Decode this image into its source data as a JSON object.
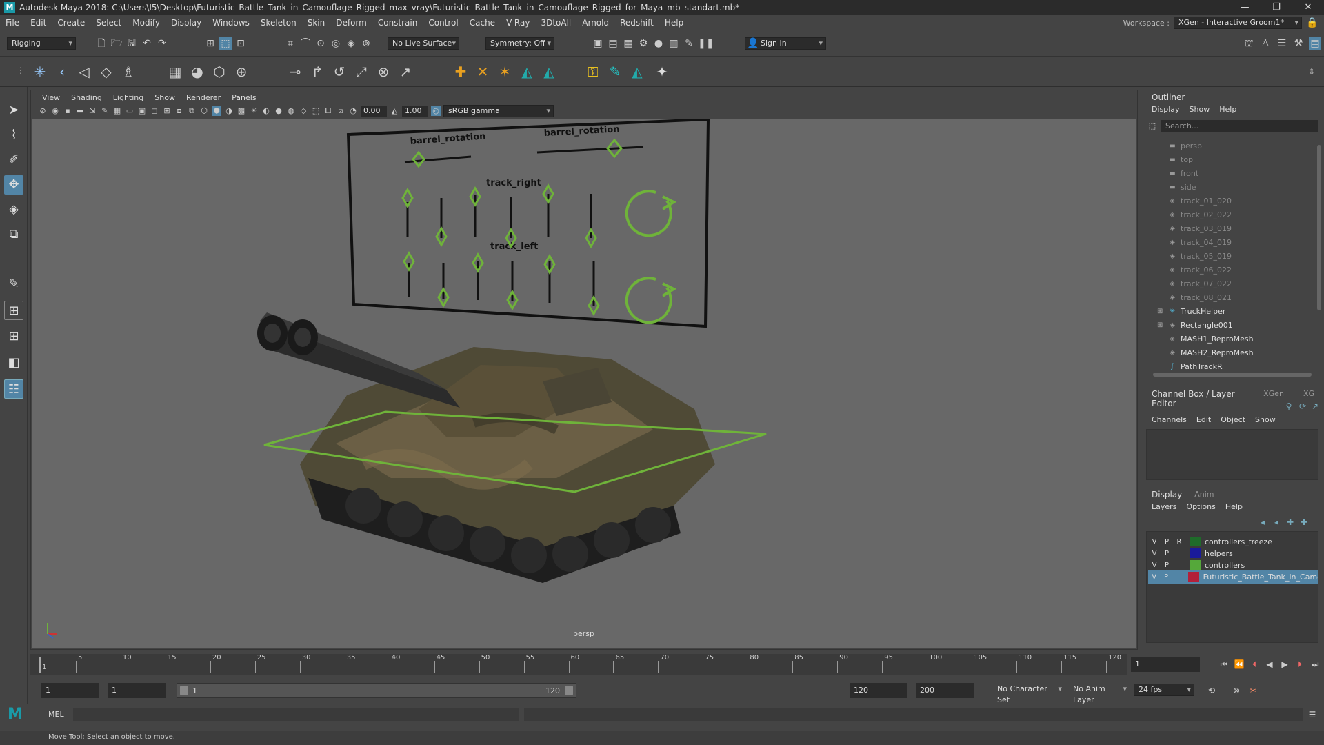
{
  "window": {
    "title": "Autodesk Maya 2018: C:\\Users\\I5\\Desktop\\Futuristic_Battle_Tank_in_Camouflage_Rigged_max_vray\\Futuristic_Battle_Tank_in_Camouflage_Rigged_for_Maya_mb_standart.mb*",
    "app_icon": "M"
  },
  "menu": [
    "File",
    "Edit",
    "Create",
    "Select",
    "Modify",
    "Display",
    "Windows",
    "Skeleton",
    "Skin",
    "Deform",
    "Constrain",
    "Control",
    "Cache",
    "V-Ray",
    "3DtoAll",
    "Arnold",
    "Redshift",
    "Help"
  ],
  "workspace": {
    "label": "Workspace :",
    "value": "XGen - Interactive Groom1*"
  },
  "status_line": {
    "mode": "Rigging",
    "live_surface": "No Live Surface",
    "symmetry": "Symmetry: Off",
    "sign_in": "Sign In"
  },
  "viewport": {
    "menus": [
      "View",
      "Shading",
      "Lighting",
      "Show",
      "Renderer",
      "Panels"
    ],
    "exposure": "0.00",
    "gamma": "1.00",
    "color_space": "sRGB gamma",
    "camera_label": "persp",
    "rig_labels": {
      "barrel_rotation_left": "barrel_rotation",
      "barrel_rotation_right": "barrel_rotation",
      "track_right": "track_right",
      "track_left": "track_left"
    }
  },
  "outliner": {
    "title": "Outliner",
    "menus": [
      "Display",
      "Show",
      "Help"
    ],
    "search_placeholder": "Search...",
    "items": [
      {
        "label": "persp",
        "icon": "camera-icon",
        "dim": true
      },
      {
        "label": "top",
        "icon": "camera-icon",
        "dim": true
      },
      {
        "label": "front",
        "icon": "camera-icon",
        "dim": true
      },
      {
        "label": "side",
        "icon": "camera-icon",
        "dim": true
      },
      {
        "label": "track_01_020",
        "icon": "mesh-icon",
        "dim": true
      },
      {
        "label": "track_02_022",
        "icon": "mesh-icon",
        "dim": true
      },
      {
        "label": "track_03_019",
        "icon": "mesh-icon",
        "dim": true
      },
      {
        "label": "track_04_019",
        "icon": "mesh-icon",
        "dim": true
      },
      {
        "label": "track_05_019",
        "icon": "mesh-icon",
        "dim": true
      },
      {
        "label": "track_06_022",
        "icon": "mesh-icon",
        "dim": true
      },
      {
        "label": "track_07_022",
        "icon": "mesh-icon",
        "dim": true
      },
      {
        "label": "track_08_021",
        "icon": "mesh-icon",
        "dim": true
      },
      {
        "label": "TruckHelper",
        "icon": "helper-icon",
        "dim": false,
        "expandable": true
      },
      {
        "label": "Rectangle001",
        "icon": "mesh-icon",
        "dim": false,
        "expandable": true
      },
      {
        "label": "MASH1_ReproMesh",
        "icon": "mesh-icon",
        "dim": false
      },
      {
        "label": "MASH2_ReproMesh",
        "icon": "mesh-icon",
        "dim": false
      },
      {
        "label": "PathTrackR",
        "icon": "curve-icon",
        "dim": false
      }
    ]
  },
  "channel_box": {
    "tabs": [
      "Channel Box / Layer Editor",
      "XGen",
      "XG"
    ],
    "menus": [
      "Channels",
      "Edit",
      "Object",
      "Show"
    ]
  },
  "layer_editor": {
    "tabs": [
      "Display",
      "Anim"
    ],
    "menus": [
      "Layers",
      "Options",
      "Help"
    ],
    "layers": [
      {
        "v": "V",
        "p": "P",
        "r": "R",
        "color": "#1f6b2a",
        "name": "controllers_freeze",
        "selected": false
      },
      {
        "v": "V",
        "p": "P",
        "r": "",
        "color": "#1a1a9a",
        "name": "helpers",
        "selected": false
      },
      {
        "v": "V",
        "p": "P",
        "r": "",
        "color": "#55a83a",
        "name": "controllers",
        "selected": false
      },
      {
        "v": "V",
        "p": "P",
        "r": "",
        "color": "#b3203a",
        "name": "Futuristic_Battle_Tank_in_Camo",
        "selected": true
      }
    ]
  },
  "timeline": {
    "ticks": [
      "1",
      "5",
      "10",
      "15",
      "20",
      "25",
      "30",
      "35",
      "40",
      "45",
      "50",
      "55",
      "60",
      "65",
      "70",
      "75",
      "80",
      "85",
      "90",
      "95",
      "100",
      "105",
      "110",
      "115",
      "120"
    ],
    "current_frame": "1"
  },
  "range": {
    "start": "1",
    "playback_start": "1",
    "slider_start": "1",
    "slider_end": "120",
    "playback_end": "120",
    "end": "200",
    "character_set": "No Character Set",
    "anim_layer": "No Anim Layer",
    "fps": "24 fps"
  },
  "command_line": {
    "label": "MEL"
  },
  "help_line": "Move Tool: Select an object to move."
}
